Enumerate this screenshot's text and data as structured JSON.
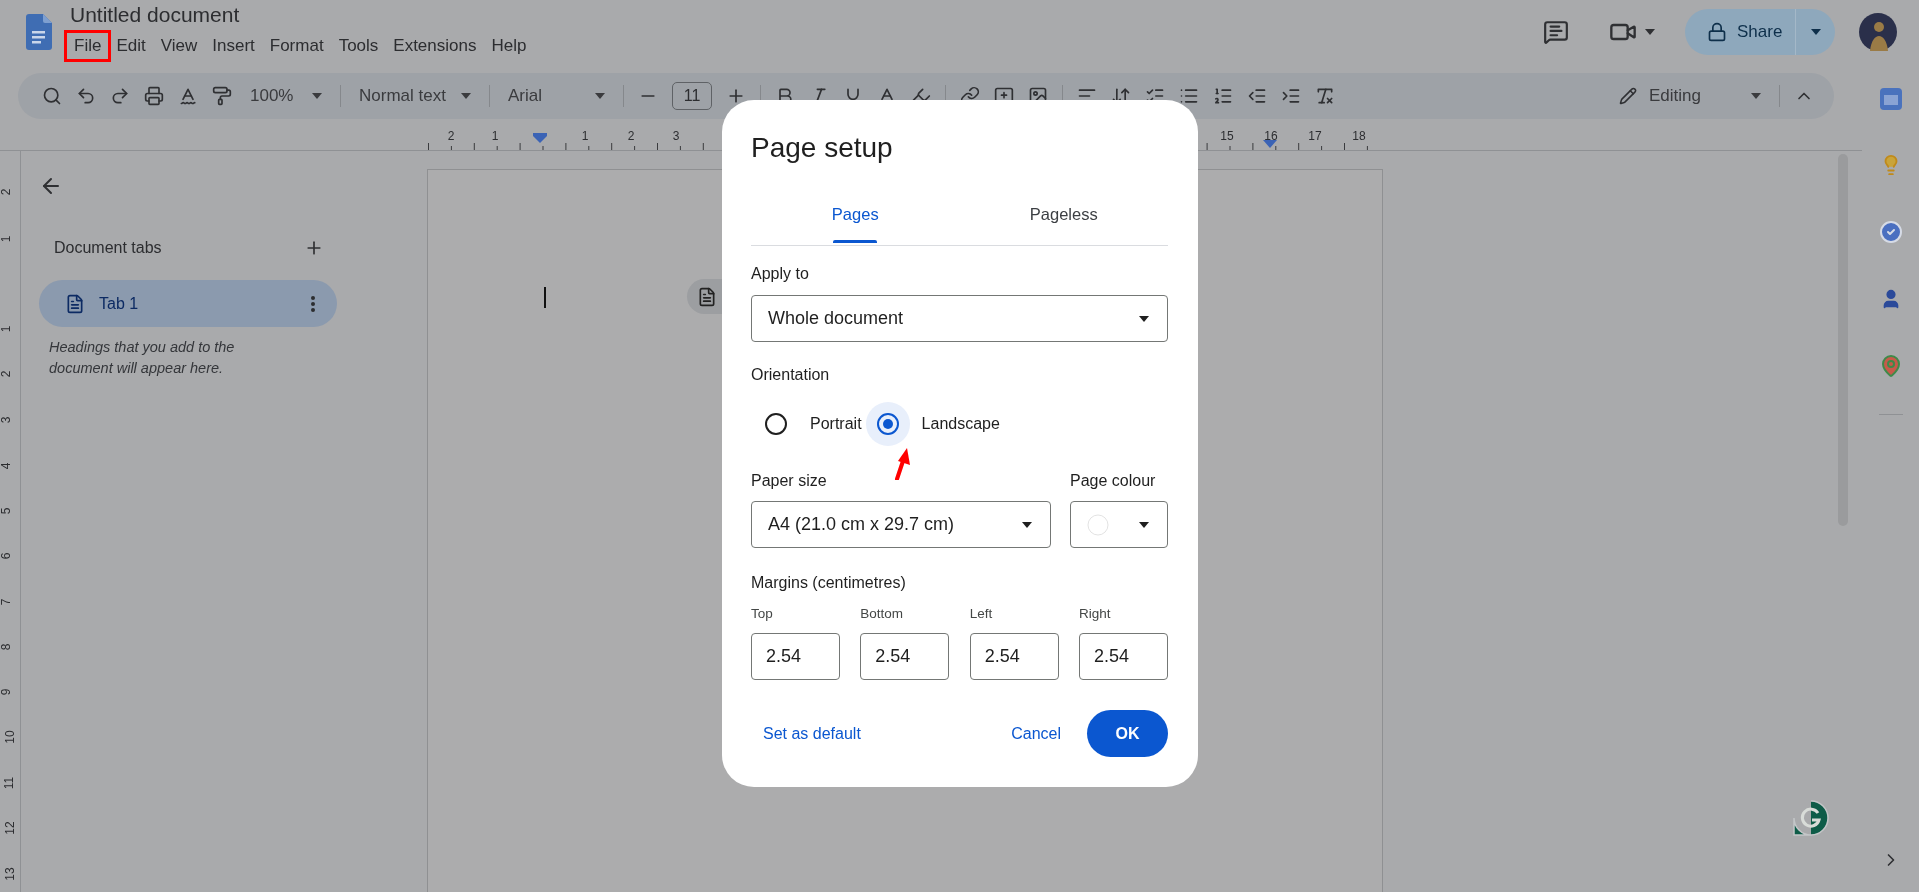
{
  "document": {
    "title": "Untitled document"
  },
  "menu": [
    {
      "label": "File",
      "highlighted": true
    },
    {
      "label": "Edit",
      "highlighted": false
    },
    {
      "label": "View",
      "highlighted": false
    },
    {
      "label": "Insert",
      "highlighted": false
    },
    {
      "label": "Format",
      "highlighted": false
    },
    {
      "label": "Tools",
      "highlighted": false
    },
    {
      "label": "Extensions",
      "highlighted": false
    },
    {
      "label": "Help",
      "highlighted": false
    }
  ],
  "share": {
    "label": "Share"
  },
  "toolbar": {
    "zoom": "100%",
    "style": "Normal text",
    "font": "Arial",
    "font_size": "11",
    "mode": "Editing"
  },
  "ruler": {
    "marks": [
      "2",
      "1",
      "1",
      "2",
      "3",
      "15",
      "16",
      "17",
      "18"
    ]
  },
  "vertical_ruler": {
    "marks": [
      "2",
      "1",
      "1",
      "2",
      "3",
      "4",
      "5",
      "6",
      "7",
      "8",
      "9",
      "10",
      "11",
      "12",
      "13"
    ]
  },
  "sidebar": {
    "heading": "Document tabs",
    "tabs": [
      {
        "label": "Tab 1",
        "selected": true
      }
    ],
    "hint": "Headings that you add to the document will appear here."
  },
  "dialog": {
    "title": "Page setup",
    "tabs": [
      {
        "label": "Pages",
        "selected": true
      },
      {
        "label": "Pageless",
        "selected": false
      }
    ],
    "apply_to": {
      "label": "Apply to",
      "value": "Whole document"
    },
    "orientation": {
      "label": "Orientation",
      "options": [
        {
          "label": "Portrait",
          "selected": false
        },
        {
          "label": "Landscape",
          "selected": true
        }
      ]
    },
    "paper_size": {
      "label": "Paper size",
      "value": "A4 (21.0 cm x 29.7 cm)"
    },
    "page_colour": {
      "label": "Page colour"
    },
    "margins": {
      "label": "Margins (centimetres)",
      "fields": [
        {
          "label": "Top",
          "value": "2.54"
        },
        {
          "label": "Bottom",
          "value": "2.54"
        },
        {
          "label": "Left",
          "value": "2.54"
        },
        {
          "label": "Right",
          "value": "2.54"
        }
      ]
    },
    "buttons": [
      {
        "label": "Set as default",
        "kind": "text"
      },
      {
        "label": "Cancel",
        "kind": "text"
      },
      {
        "label": "OK",
        "kind": "filled"
      }
    ]
  }
}
